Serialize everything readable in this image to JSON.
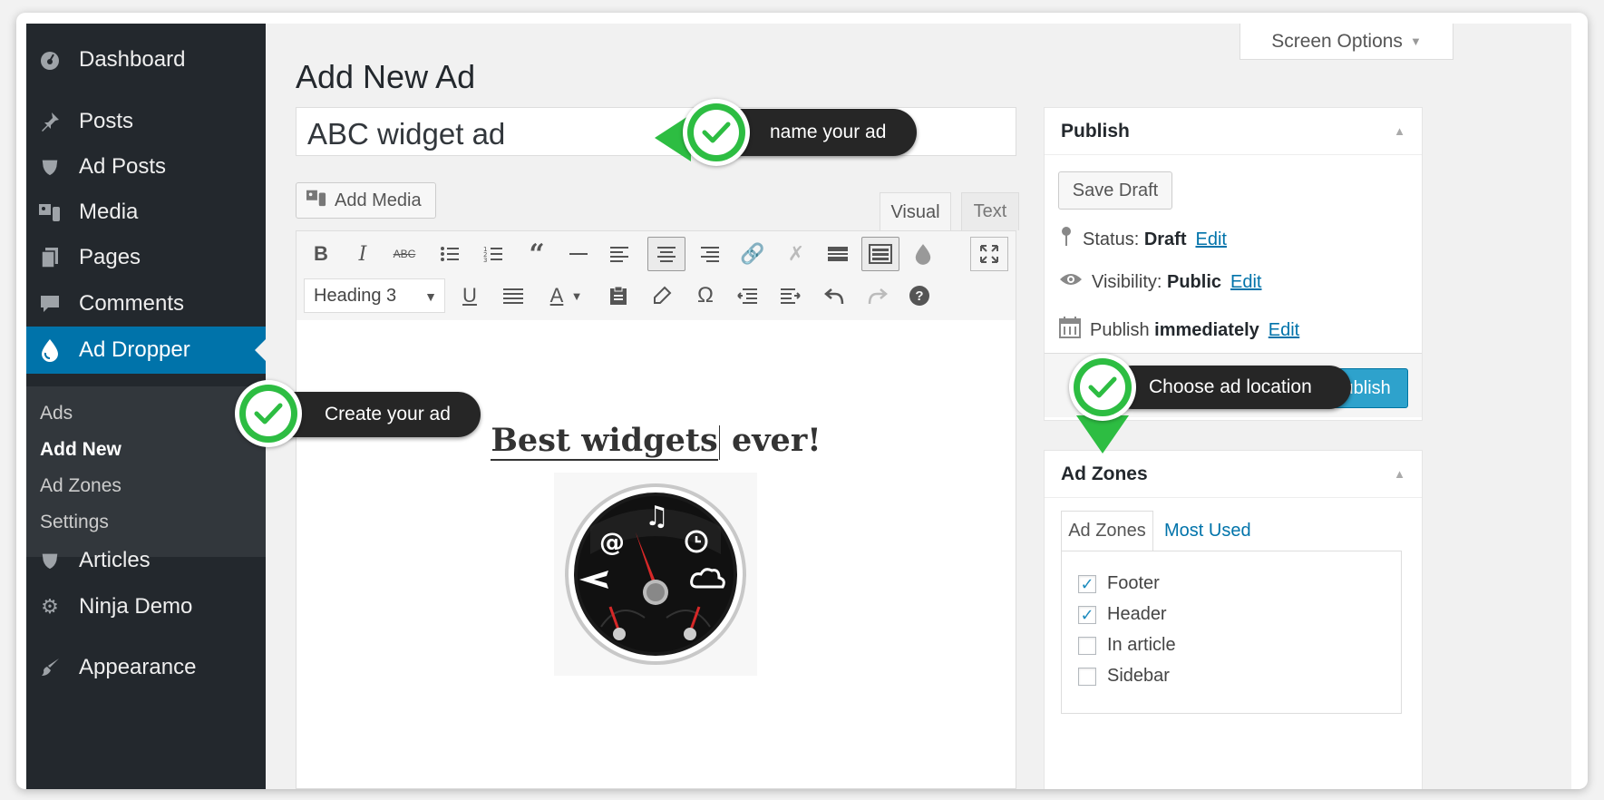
{
  "sidebar": {
    "items": [
      {
        "label": "Dashboard",
        "icon": "dashboard-icon"
      },
      {
        "label": "Posts",
        "icon": "pin-icon"
      },
      {
        "label": "Ad Posts",
        "icon": "shield-icon"
      },
      {
        "label": "Media",
        "icon": "media-icon"
      },
      {
        "label": "Pages",
        "icon": "pages-icon"
      },
      {
        "label": "Comments",
        "icon": "comment-icon"
      },
      {
        "label": "Ad Dropper",
        "icon": "drop-icon",
        "active": true
      },
      {
        "label": "Articles",
        "icon": "shield-icon"
      },
      {
        "label": "Ninja Demo",
        "icon": "gear-icon"
      },
      {
        "label": "Appearance",
        "icon": "brush-icon"
      }
    ],
    "submenu": [
      "Ads",
      "Add New",
      "Ad Zones",
      "Settings"
    ]
  },
  "header": {
    "title": "Add New Ad",
    "screen_options": "Screen Options"
  },
  "editor": {
    "title_value": "ABC widget ad",
    "add_media": "Add Media",
    "tab_visual": "Visual",
    "tab_text": "Text",
    "format_select": "Heading 3",
    "content_heading_part1": "Best widgets",
    "content_heading_part2": " ever!"
  },
  "publish": {
    "title": "Publish",
    "save_draft": "Save Draft",
    "status_label": "Status: ",
    "status_value": "Draft",
    "visibility_label": "Visibility: ",
    "visibility_value": "Public",
    "publish_label": "Publish ",
    "publish_value": "immediately",
    "edit": "Edit",
    "publish_button": "Publish"
  },
  "ad_zones": {
    "title": "Ad Zones",
    "tab_all": "Ad Zones",
    "tab_most_used": "Most Used",
    "zones": [
      {
        "label": "Footer",
        "checked": true
      },
      {
        "label": "Header",
        "checked": true
      },
      {
        "label": "In article",
        "checked": false
      },
      {
        "label": "Sidebar",
        "checked": false
      }
    ]
  },
  "callouts": {
    "name": "name your ad",
    "create": "Create your ad",
    "location": "Choose ad location"
  },
  "colors": {
    "sidebar_bg": "#23282d",
    "active_blue": "#0073aa",
    "callout_green": "#2dbd42",
    "callout_dark": "#262626",
    "publish_blue": "#2ea2cc"
  }
}
